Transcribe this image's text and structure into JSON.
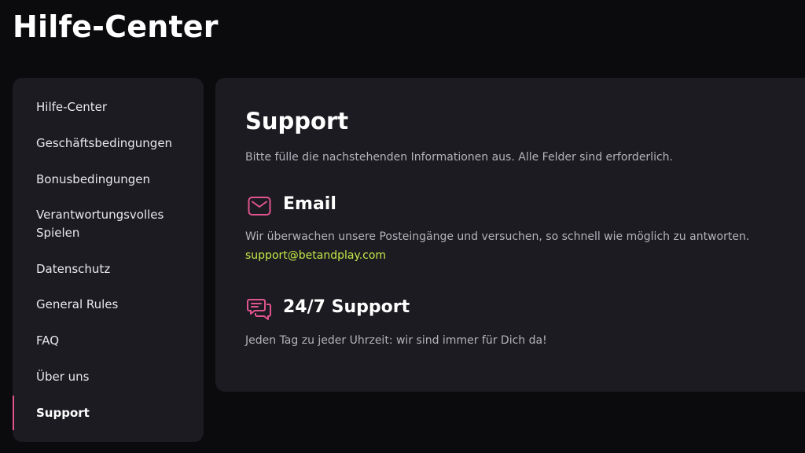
{
  "page": {
    "title": "Hilfe-Center"
  },
  "sidebar": {
    "items": [
      {
        "label": "Hilfe-Center"
      },
      {
        "label": "Geschäftsbedingungen"
      },
      {
        "label": "Bonusbedingungen"
      },
      {
        "label": "Verantwortungsvolles Spielen"
      },
      {
        "label": "Datenschutz"
      },
      {
        "label": "General Rules"
      },
      {
        "label": "FAQ"
      },
      {
        "label": "Über uns"
      },
      {
        "label": "Support"
      }
    ],
    "active_item": "Support"
  },
  "main": {
    "title": "Support",
    "intro": "Bitte fülle die nachstehenden Informationen aus. Alle Felder sind erforderlich.",
    "email": {
      "icon": "mail-icon",
      "heading": "Email",
      "text": "Wir überwachen unsere Posteingänge und versuchen, so schnell wie möglich zu antworten.",
      "link": "support@betandplay.com"
    },
    "support247": {
      "icon": "chat-icon",
      "heading": "24/7 Support",
      "text": "Jeden Tag zu jeder Uhrzeit: wir sind immer für Dich da!"
    }
  },
  "colors": {
    "background": "#0b0a0d",
    "panel": "#1c1b21",
    "accent": "#e0548f",
    "link": "#c6e84a",
    "muted_text": "#b4b3ba"
  }
}
